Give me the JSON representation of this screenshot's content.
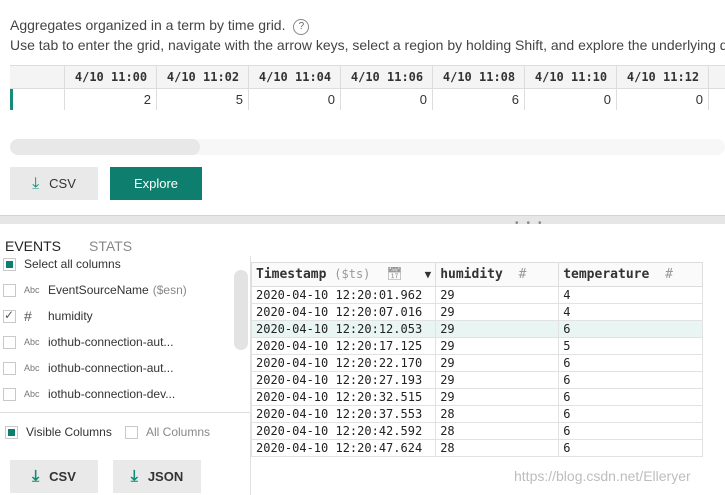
{
  "header": {
    "description": "Aggregates organized in a term by time grid.",
    "help_icon": "question-circle-icon",
    "instructions": "Use tab to enter the grid, navigate with the arrow keys, select a region by holding Shift, and explore the underlying d"
  },
  "grid": {
    "columns": [
      {
        "time": "4/10 11:00",
        "value": "2"
      },
      {
        "time": "4/10 11:02",
        "value": "5"
      },
      {
        "time": "4/10 11:04",
        "value": "0"
      },
      {
        "time": "4/10 11:06",
        "value": "0"
      },
      {
        "time": "4/10 11:08",
        "value": "6"
      },
      {
        "time": "4/10 11:10",
        "value": "0"
      },
      {
        "time": "4/10 11:12",
        "value": "0"
      },
      {
        "time": "4",
        "value": ""
      }
    ]
  },
  "actions": {
    "csv_label": "CSV",
    "explore_label": "Explore",
    "download_icon": "download-arrow-icon"
  },
  "tabs": {
    "events": "EVENTS",
    "stats": "STATS"
  },
  "columns_panel": {
    "select_all": "Select all columns",
    "items": [
      {
        "type": "Abc",
        "name": "EventSourceName",
        "suffix": "($esn)",
        "checked": false
      },
      {
        "type": "#",
        "name": "humidity",
        "suffix": "",
        "checked": true
      },
      {
        "type": "Abc",
        "name": "iothub-connection-aut...",
        "suffix": "",
        "checked": false
      },
      {
        "type": "Abc",
        "name": "iothub-connection-aut...",
        "suffix": "",
        "checked": false
      },
      {
        "type": "Abc",
        "name": "iothub-connection-dev...",
        "suffix": "",
        "checked": false
      }
    ],
    "visible_columns": "Visible Columns",
    "all_columns": "All Columns",
    "csv_label": "CSV",
    "json_label": "JSON"
  },
  "events_table": {
    "headers": [
      {
        "name": "Timestamp",
        "sub": "($ts)",
        "icon": "calendar-icon",
        "sort": "▼"
      },
      {
        "name": "humidity",
        "sub": "",
        "icon": "#",
        "sort": ""
      },
      {
        "name": "temperature",
        "sub": "",
        "icon": "#",
        "sort": ""
      }
    ],
    "rows": [
      [
        "2020-04-10 12:20:01.962",
        "29",
        "4"
      ],
      [
        "2020-04-10 12:20:07.016",
        "29",
        "4"
      ],
      [
        "2020-04-10 12:20:12.053",
        "29",
        "6"
      ],
      [
        "2020-04-10 12:20:17.125",
        "29",
        "5"
      ],
      [
        "2020-04-10 12:20:22.170",
        "29",
        "6"
      ],
      [
        "2020-04-10 12:20:27.193",
        "29",
        "6"
      ],
      [
        "2020-04-10 12:20:32.515",
        "29",
        "6"
      ],
      [
        "2020-04-10 12:20:37.553",
        "28",
        "6"
      ],
      [
        "2020-04-10 12:20:42.592",
        "28",
        "6"
      ],
      [
        "2020-04-10 12:20:47.624",
        "28",
        "6"
      ]
    ],
    "highlighted_row": 2
  },
  "watermark": "https://blog.csdn.net/Elleryer",
  "colors": {
    "accent": "#0e7f6e",
    "highlight_row": "#e9f5f2"
  }
}
